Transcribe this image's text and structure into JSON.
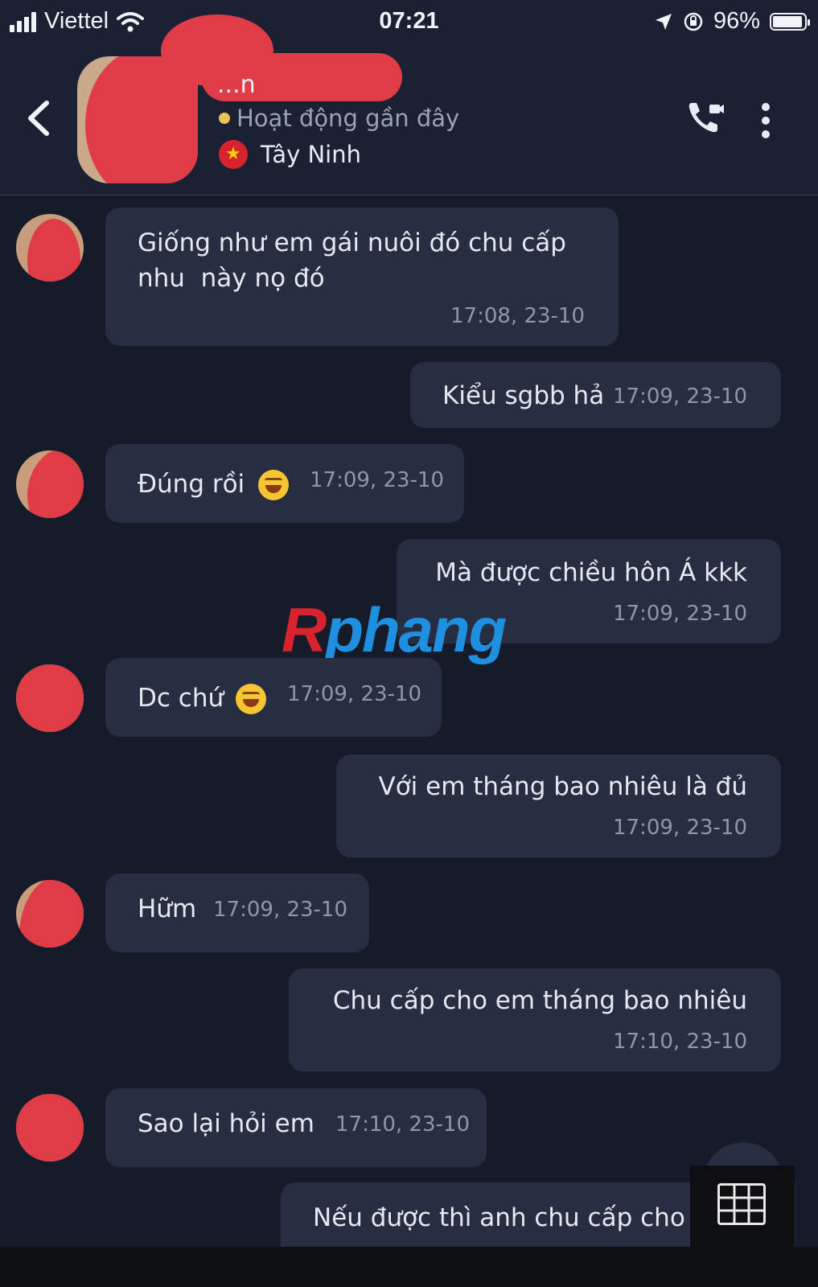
{
  "status_bar": {
    "carrier": "Viettel",
    "time": "07:21",
    "battery": "96%"
  },
  "header": {
    "contact_name": "...n",
    "activity": "Hoạt động gần đây",
    "location": "Tây Ninh"
  },
  "messages": [
    {
      "side": "in",
      "text_line1": "Giống như em gái nuôi đó chu cấp",
      "text_line2": "nhu  này nọ đó",
      "time": "17:08, 23-10"
    },
    {
      "side": "out",
      "text": "Kiểu sgbb hả",
      "time": "17:09, 23-10"
    },
    {
      "side": "in",
      "text": "Đúng rồi",
      "emoji": "rolling-on-floor-laughing",
      "time": "17:09, 23-10"
    },
    {
      "side": "out",
      "text": "Mà được chiều hôn Á kkk",
      "time": "17:09, 23-10"
    },
    {
      "side": "in",
      "text": "Dc chứ",
      "emoji": "rolling-on-floor-laughing",
      "time": "17:09, 23-10"
    },
    {
      "side": "out",
      "text": "Với em tháng bao nhiêu là đủ",
      "time": "17:09, 23-10"
    },
    {
      "side": "in",
      "text": "Hữm",
      "time": "17:09, 23-10"
    },
    {
      "side": "out",
      "text": "Chu cấp cho em tháng bao nhiêu",
      "time": "17:10, 23-10"
    },
    {
      "side": "in",
      "text": "Sao lại hỏi em",
      "time": "17:10, 23-10"
    },
    {
      "side": "out",
      "text": "Nếu được thì anh chu cấp cho",
      "time": ""
    }
  ],
  "watermark": {
    "part1": "R",
    "part2": "phang"
  },
  "colors": {
    "background": "#161b2a",
    "bubble": "#272e42",
    "redaction": "#e03c48",
    "timestamp": "#8f97ab"
  }
}
